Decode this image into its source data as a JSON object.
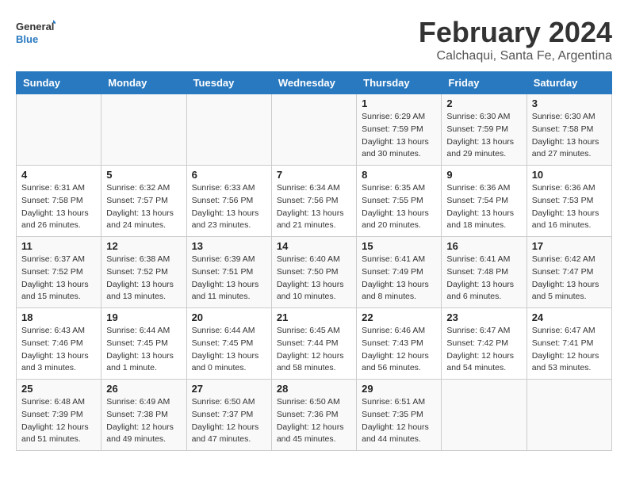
{
  "logo": {
    "line1": "General",
    "line2": "Blue"
  },
  "title": "February 2024",
  "subtitle": "Calchaqui, Santa Fe, Argentina",
  "headers": [
    "Sunday",
    "Monday",
    "Tuesday",
    "Wednesday",
    "Thursday",
    "Friday",
    "Saturday"
  ],
  "weeks": [
    [
      {
        "day": "",
        "info": ""
      },
      {
        "day": "",
        "info": ""
      },
      {
        "day": "",
        "info": ""
      },
      {
        "day": "",
        "info": ""
      },
      {
        "day": "1",
        "info": "Sunrise: 6:29 AM\nSunset: 7:59 PM\nDaylight: 13 hours\nand 30 minutes."
      },
      {
        "day": "2",
        "info": "Sunrise: 6:30 AM\nSunset: 7:59 PM\nDaylight: 13 hours\nand 29 minutes."
      },
      {
        "day": "3",
        "info": "Sunrise: 6:30 AM\nSunset: 7:58 PM\nDaylight: 13 hours\nand 27 minutes."
      }
    ],
    [
      {
        "day": "4",
        "info": "Sunrise: 6:31 AM\nSunset: 7:58 PM\nDaylight: 13 hours\nand 26 minutes."
      },
      {
        "day": "5",
        "info": "Sunrise: 6:32 AM\nSunset: 7:57 PM\nDaylight: 13 hours\nand 24 minutes."
      },
      {
        "day": "6",
        "info": "Sunrise: 6:33 AM\nSunset: 7:56 PM\nDaylight: 13 hours\nand 23 minutes."
      },
      {
        "day": "7",
        "info": "Sunrise: 6:34 AM\nSunset: 7:56 PM\nDaylight: 13 hours\nand 21 minutes."
      },
      {
        "day": "8",
        "info": "Sunrise: 6:35 AM\nSunset: 7:55 PM\nDaylight: 13 hours\nand 20 minutes."
      },
      {
        "day": "9",
        "info": "Sunrise: 6:36 AM\nSunset: 7:54 PM\nDaylight: 13 hours\nand 18 minutes."
      },
      {
        "day": "10",
        "info": "Sunrise: 6:36 AM\nSunset: 7:53 PM\nDaylight: 13 hours\nand 16 minutes."
      }
    ],
    [
      {
        "day": "11",
        "info": "Sunrise: 6:37 AM\nSunset: 7:52 PM\nDaylight: 13 hours\nand 15 minutes."
      },
      {
        "day": "12",
        "info": "Sunrise: 6:38 AM\nSunset: 7:52 PM\nDaylight: 13 hours\nand 13 minutes."
      },
      {
        "day": "13",
        "info": "Sunrise: 6:39 AM\nSunset: 7:51 PM\nDaylight: 13 hours\nand 11 minutes."
      },
      {
        "day": "14",
        "info": "Sunrise: 6:40 AM\nSunset: 7:50 PM\nDaylight: 13 hours\nand 10 minutes."
      },
      {
        "day": "15",
        "info": "Sunrise: 6:41 AM\nSunset: 7:49 PM\nDaylight: 13 hours\nand 8 minutes."
      },
      {
        "day": "16",
        "info": "Sunrise: 6:41 AM\nSunset: 7:48 PM\nDaylight: 13 hours\nand 6 minutes."
      },
      {
        "day": "17",
        "info": "Sunrise: 6:42 AM\nSunset: 7:47 PM\nDaylight: 13 hours\nand 5 minutes."
      }
    ],
    [
      {
        "day": "18",
        "info": "Sunrise: 6:43 AM\nSunset: 7:46 PM\nDaylight: 13 hours\nand 3 minutes."
      },
      {
        "day": "19",
        "info": "Sunrise: 6:44 AM\nSunset: 7:45 PM\nDaylight: 13 hours\nand 1 minute."
      },
      {
        "day": "20",
        "info": "Sunrise: 6:44 AM\nSunset: 7:45 PM\nDaylight: 13 hours\nand 0 minutes."
      },
      {
        "day": "21",
        "info": "Sunrise: 6:45 AM\nSunset: 7:44 PM\nDaylight: 12 hours\nand 58 minutes."
      },
      {
        "day": "22",
        "info": "Sunrise: 6:46 AM\nSunset: 7:43 PM\nDaylight: 12 hours\nand 56 minutes."
      },
      {
        "day": "23",
        "info": "Sunrise: 6:47 AM\nSunset: 7:42 PM\nDaylight: 12 hours\nand 54 minutes."
      },
      {
        "day": "24",
        "info": "Sunrise: 6:47 AM\nSunset: 7:41 PM\nDaylight: 12 hours\nand 53 minutes."
      }
    ],
    [
      {
        "day": "25",
        "info": "Sunrise: 6:48 AM\nSunset: 7:39 PM\nDaylight: 12 hours\nand 51 minutes."
      },
      {
        "day": "26",
        "info": "Sunrise: 6:49 AM\nSunset: 7:38 PM\nDaylight: 12 hours\nand 49 minutes."
      },
      {
        "day": "27",
        "info": "Sunrise: 6:50 AM\nSunset: 7:37 PM\nDaylight: 12 hours\nand 47 minutes."
      },
      {
        "day": "28",
        "info": "Sunrise: 6:50 AM\nSunset: 7:36 PM\nDaylight: 12 hours\nand 45 minutes."
      },
      {
        "day": "29",
        "info": "Sunrise: 6:51 AM\nSunset: 7:35 PM\nDaylight: 12 hours\nand 44 minutes."
      },
      {
        "day": "",
        "info": ""
      },
      {
        "day": "",
        "info": ""
      }
    ]
  ]
}
